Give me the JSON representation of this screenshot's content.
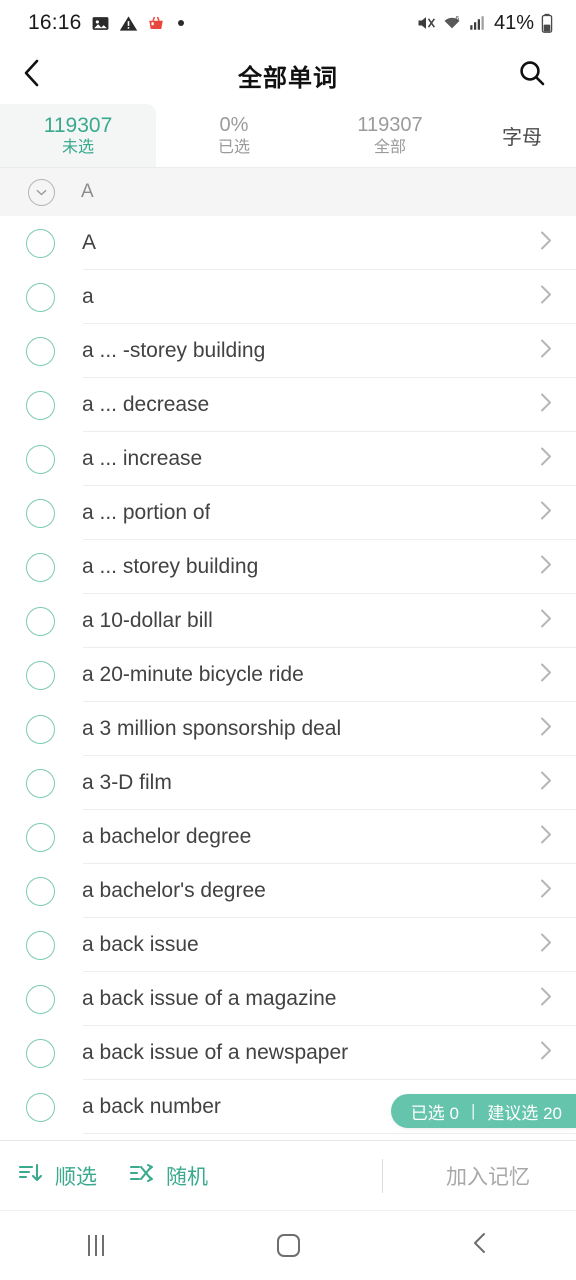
{
  "status_bar": {
    "time": "16:16",
    "battery_percent": "41%",
    "icons": [
      "image-icon",
      "warning-icon",
      "shopping-basket-icon",
      "dot-icon",
      "mute-icon",
      "wifi-icon",
      "signal-icon",
      "battery-icon"
    ]
  },
  "header": {
    "title": "全部单词",
    "back_icon": "chevron-left-icon",
    "search_icon": "search-icon"
  },
  "tabs": [
    {
      "number": "119307",
      "label": "未选",
      "active": true
    },
    {
      "number": "0%",
      "label": "已选",
      "active": false
    },
    {
      "number": "119307",
      "label": "全部",
      "active": false
    }
  ],
  "letter_tab": {
    "label": "字母"
  },
  "section": {
    "letter": "A",
    "collapse_icon": "chevron-down-circle-icon"
  },
  "words": [
    {
      "text": "A",
      "checked": false
    },
    {
      "text": "a",
      "checked": false
    },
    {
      "text": "a ... -storey building",
      "checked": false
    },
    {
      "text": "a ... decrease",
      "checked": false
    },
    {
      "text": "a ... increase",
      "checked": false
    },
    {
      "text": "a ... portion of",
      "checked": false
    },
    {
      "text": "a ... storey building",
      "checked": false
    },
    {
      "text": "a 10-dollar bill",
      "checked": false
    },
    {
      "text": "a 20-minute bicycle ride",
      "checked": false
    },
    {
      "text": "a 3 million sponsorship deal",
      "checked": false
    },
    {
      "text": "a 3-D film",
      "checked": false
    },
    {
      "text": "a bachelor degree",
      "checked": false
    },
    {
      "text": "a bachelor's degree",
      "checked": false
    },
    {
      "text": "a back issue",
      "checked": false
    },
    {
      "text": "a back issue of a magazine",
      "checked": false
    },
    {
      "text": "a back issue of a newspaper",
      "checked": false
    },
    {
      "text": "a back number",
      "checked": false
    }
  ],
  "selection_pill": {
    "selected_label": "已选 0",
    "separator": "|",
    "suggested_label": "建议选 20"
  },
  "toolbar": {
    "sequential_label": "顺选",
    "sequential_icon": "sort-descending-icon",
    "random_label": "随机",
    "random_icon": "shuffle-icon",
    "memory_label": "加入记忆"
  },
  "nav_bar": {
    "recents_icon": "recents-icon",
    "home_icon": "home-icon",
    "back_icon": "back-icon"
  },
  "colors": {
    "accent": "#3aa98d",
    "pill_bg": "#64c4ac",
    "checkbox_border": "#7fc9b6",
    "tab_active_bg": "#f3f6f5",
    "text_primary": "#424242",
    "text_muted": "#9b9b9b"
  }
}
